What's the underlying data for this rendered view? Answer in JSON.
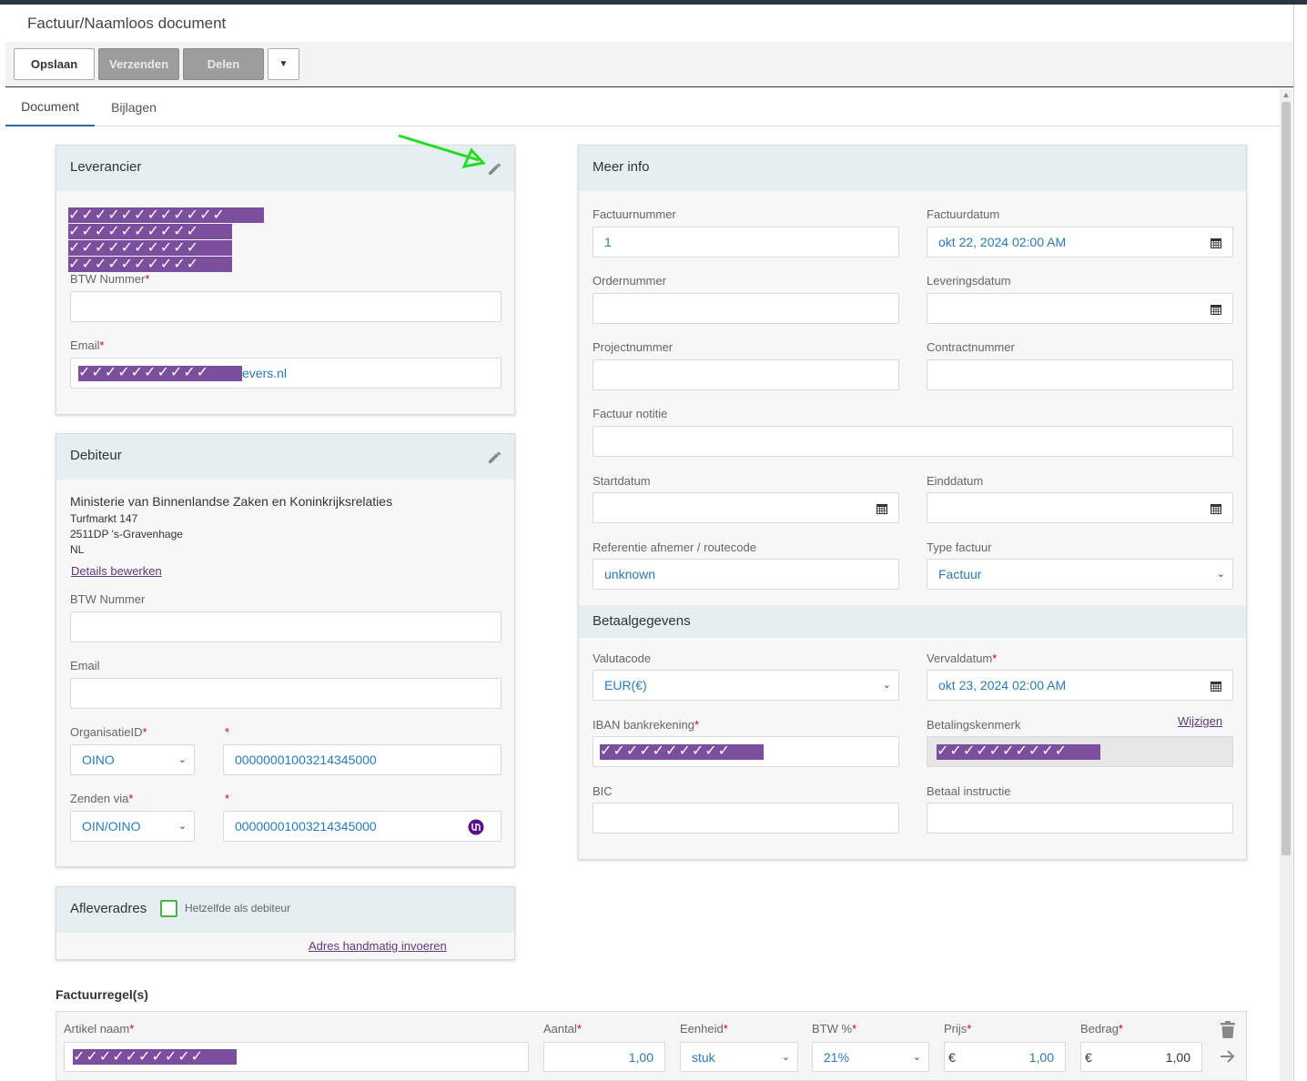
{
  "header": {
    "title": "Factuur/Naamloos document"
  },
  "toolbar": {
    "save": "Opslaan",
    "send": "Verzenden",
    "share": "Delen",
    "more_icon": "caret-down-icon"
  },
  "tabs": [
    {
      "label": "Document"
    },
    {
      "label": "Bijlagen"
    }
  ],
  "supplier": {
    "title": "Leverancier",
    "name_redacted": "✓✓✓✓✓✓✓✓✓✓✓✓",
    "address_redacted_1": "✓✓✓✓✓✓✓✓✓✓",
    "address_redacted_2": "✓✓✓✓✓✓✓✓✓✓",
    "address_redacted_3": "✓✓✓✓✓✓✓✓✓✓",
    "vat_label": "BTW Nummer",
    "vat_value": "",
    "email_label": "Email",
    "email_redacted": "✓✓✓✓✓✓✓✓✓✓",
    "email_suffix": "evers.nl"
  },
  "debtor": {
    "title": "Debiteur",
    "name": "Ministerie van Binnenlandse Zaken en Koninkrijksrelaties",
    "street": "Turfmarkt 147",
    "city": "2511DP 's-Gravenhage",
    "country": "NL",
    "edit_details": "Details bewerken",
    "vat_label": "BTW Nummer",
    "email_label": "Email",
    "org_id_label": "OrganisatieID",
    "org_id_type": "OINO",
    "org_id_value": "00000001003214345000",
    "send_via_label": "Zenden via",
    "send_via_type": "OIN/OINO",
    "send_via_value": "00000001003214345000"
  },
  "delivery": {
    "title": "Afleveradres",
    "same_as_debtor": "Hetzelfde als debiteur",
    "manual": "Adres handmatig invoeren"
  },
  "more_info": {
    "title": "Meer info",
    "invoice_number_label": "Factuurnummer",
    "invoice_number": "1",
    "invoice_date_label": "Factuurdatum",
    "invoice_date": "okt 22, 2024 02:00 AM",
    "order_number_label": "Ordernummer",
    "delivery_date_label": "Leveringsdatum",
    "project_number_label": "Projectnummer",
    "contract_number_label": "Contractnummer",
    "note_label": "Factuur notitie",
    "start_date_label": "Startdatum",
    "end_date_label": "Einddatum",
    "reference_label": "Referentie afnemer / routecode",
    "reference": "unknown",
    "invoice_type_label": "Type factuur",
    "invoice_type": "Factuur"
  },
  "payment": {
    "title": "Betaalgegevens",
    "currency_label": "Valutacode",
    "currency": "EUR(€)",
    "due_date_label": "Vervaldatum",
    "due_date": "okt 23, 2024 02:00 AM",
    "iban_label": "IBAN bankrekening",
    "iban_redacted": "✓✓✓✓✓✓✓✓✓✓",
    "reference_label": "Betalingskenmerk",
    "change": "Wijzigen",
    "reference_redacted": "✓✓✓✓✓✓✓✓✓✓",
    "bic_label": "BIC",
    "instruction_label": "Betaal instructie"
  },
  "lines": {
    "title": "Factuurregel(s)",
    "article_label": "Artikel naam",
    "article_redacted": "✓✓✓✓✓✓✓✓✓✓",
    "quantity_label": "Aantal",
    "quantity": "1,00",
    "unit_label": "Eenheid",
    "unit": "stuk",
    "vat_label": "BTW %",
    "vat": "21%",
    "price_label": "Prijs",
    "price_currency": "€",
    "price": "1,00",
    "amount_label": "Bedrag",
    "amount_currency": "€",
    "amount": "1,00"
  },
  "colors": {
    "accent": "#2a7ab8",
    "redaction": "#7b4f9e",
    "required": "#d0021b",
    "annotation": "#22dd22"
  }
}
